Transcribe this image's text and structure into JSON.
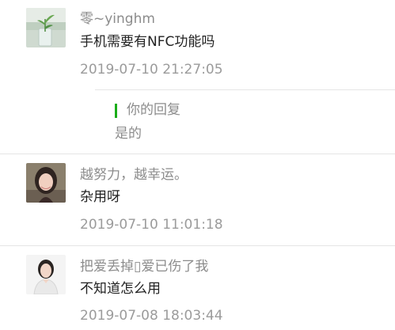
{
  "comments": [
    {
      "username": "零~yinghm",
      "content": "手机需要有NFC功能吗",
      "time": "2019-07-10 21:27:05",
      "reply": {
        "label": "你的回复",
        "text": "是的"
      }
    },
    {
      "username": "越努力，越幸运。",
      "content": "杂用呀",
      "time": "2019-07-10 11:01:18"
    },
    {
      "username": "把爱丢掉▯爱已伤了我",
      "content": "不知道怎么用",
      "time": "2019-07-08 18:03:44"
    }
  ],
  "colors": {
    "reply_bar": "#1aad19",
    "username": "#8c8c8c",
    "content": "#222222",
    "time": "#9b9b9b"
  }
}
